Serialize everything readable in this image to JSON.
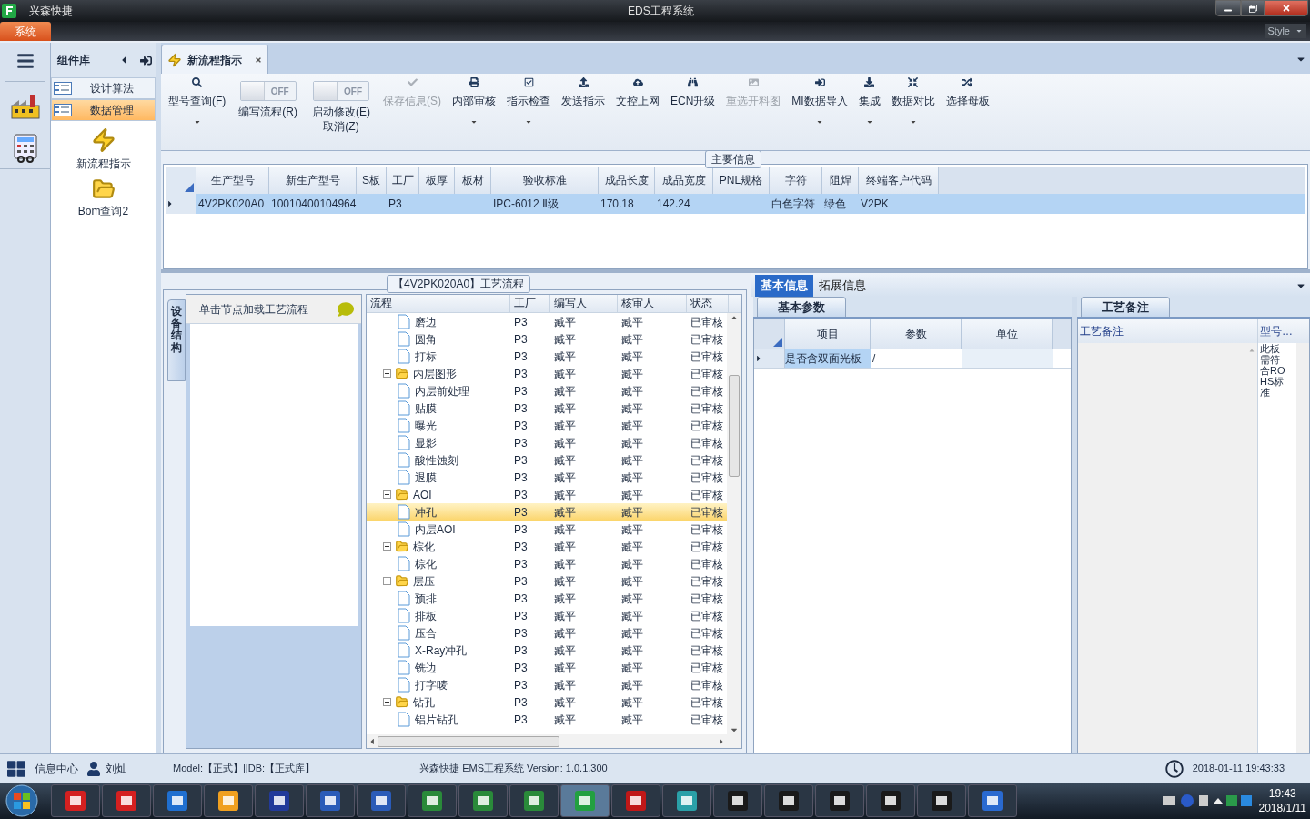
{
  "window": {
    "app_name": "兴森快捷",
    "title": "EDS工程系统"
  },
  "ribbon_tabs": [
    {
      "label": "系统",
      "selected": true
    }
  ],
  "style_menu": {
    "label": "Style"
  },
  "component_panel": {
    "title": "组件库",
    "items": [
      {
        "label": "设计算法",
        "selected": false
      },
      {
        "label": "数据管理",
        "selected": true
      }
    ],
    "tools": [
      {
        "label": "新流程指示"
      },
      {
        "label": "Bom查询2"
      }
    ]
  },
  "document_tabs": [
    {
      "label": "新流程指示",
      "selected": true
    }
  ],
  "toolbar": [
    {
      "kind": "button",
      "label": "型号查询(F)",
      "disabled": false,
      "dropdown": true
    },
    {
      "kind": "toggle",
      "label": "编写流程(R)",
      "switch_text": "OFF",
      "on": false
    },
    {
      "kind": "toggle",
      "label": "启动修改(E)\n取消(Z)",
      "switch_text": "OFF",
      "on": false
    },
    {
      "kind": "button",
      "label": "保存信息(S)",
      "disabled": true,
      "dropdown": false
    },
    {
      "kind": "button",
      "label": "内部审核",
      "disabled": false,
      "dropdown": true
    },
    {
      "kind": "button",
      "label": "指示检查",
      "disabled": false,
      "dropdown": true
    },
    {
      "kind": "button",
      "label": "发送指示",
      "disabled": false,
      "dropdown": false
    },
    {
      "kind": "button",
      "label": "文控上网",
      "disabled": false,
      "dropdown": false
    },
    {
      "kind": "button",
      "label": "ECN升级",
      "disabled": false,
      "dropdown": false
    },
    {
      "kind": "button",
      "label": "重选开料图",
      "disabled": true,
      "dropdown": false
    },
    {
      "kind": "button",
      "label": "MI数据导入",
      "disabled": false,
      "dropdown": true
    },
    {
      "kind": "button",
      "label": "集成",
      "disabled": false,
      "dropdown": true
    },
    {
      "kind": "button",
      "label": "数据对比",
      "disabled": false,
      "dropdown": true
    },
    {
      "kind": "button",
      "label": "选择母板",
      "disabled": false,
      "dropdown": false
    }
  ],
  "main_info": {
    "title": "主要信息",
    "columns": [
      "生产型号",
      "新生产型号",
      "S板",
      "工厂",
      "板厚",
      "板材",
      "验收标准",
      "成品长度",
      "成品宽度",
      "PNL规格",
      "字符",
      "阻焊",
      "终端客户代码"
    ],
    "rows": [
      {
        "selected": true,
        "cells": [
          "4V2PK020A0",
          "10010400104964",
          null,
          "P3",
          null,
          null,
          "IPC-6012 Ⅱ级",
          "170.18",
          "142.24",
          null,
          "白色字符",
          "绿色",
          "V2PK"
        ]
      }
    ]
  },
  "process_panel": {
    "title": "【4V2PK020A0】工艺流程",
    "side_tab": "设备结构",
    "hint": "单击节点加载工艺流程",
    "columns": [
      "流程",
      "工厂",
      "编写人",
      "核审人",
      "状态"
    ],
    "nodes": [
      {
        "kind": "leaf",
        "name": "磨边",
        "factory": "P3",
        "writer": "臧平",
        "reviewer": "臧平",
        "status": "已审核",
        "selected": false
      },
      {
        "kind": "leaf",
        "name": "圆角",
        "factory": "P3",
        "writer": "臧平",
        "reviewer": "臧平",
        "status": "已审核",
        "selected": false
      },
      {
        "kind": "leaf",
        "name": "打标",
        "factory": "P3",
        "writer": "臧平",
        "reviewer": "臧平",
        "status": "已审核",
        "selected": false
      },
      {
        "kind": "folder",
        "name": "内层图形",
        "factory": "P3",
        "writer": "臧平",
        "reviewer": "臧平",
        "status": "已审核",
        "selected": false,
        "expanded": true,
        "children": [
          {
            "kind": "leaf",
            "name": "内层前处理",
            "factory": "P3",
            "writer": "臧平",
            "reviewer": "臧平",
            "status": "已审核",
            "selected": false
          },
          {
            "kind": "leaf",
            "name": "贴膜",
            "factory": "P3",
            "writer": "臧平",
            "reviewer": "臧平",
            "status": "已审核",
            "selected": false
          },
          {
            "kind": "leaf",
            "name": "曝光",
            "factory": "P3",
            "writer": "臧平",
            "reviewer": "臧平",
            "status": "已审核",
            "selected": false
          },
          {
            "kind": "leaf",
            "name": "显影",
            "factory": "P3",
            "writer": "臧平",
            "reviewer": "臧平",
            "status": "已审核",
            "selected": false
          },
          {
            "kind": "leaf",
            "name": "酸性蚀刻",
            "factory": "P3",
            "writer": "臧平",
            "reviewer": "臧平",
            "status": "已审核",
            "selected": false
          },
          {
            "kind": "leaf",
            "name": "退膜",
            "factory": "P3",
            "writer": "臧平",
            "reviewer": "臧平",
            "status": "已审核",
            "selected": false
          }
        ]
      },
      {
        "kind": "folder",
        "name": "AOI",
        "factory": "P3",
        "writer": "臧平",
        "reviewer": "臧平",
        "status": "已审核",
        "selected": false,
        "expanded": true,
        "children": [
          {
            "kind": "leaf",
            "name": "冲孔",
            "factory": "P3",
            "writer": "臧平",
            "reviewer": "臧平",
            "status": "已审核",
            "selected": true
          },
          {
            "kind": "leaf",
            "name": "内层AOI",
            "factory": "P3",
            "writer": "臧平",
            "reviewer": "臧平",
            "status": "已审核",
            "selected": false
          }
        ]
      },
      {
        "kind": "folder",
        "name": "棕化",
        "factory": "P3",
        "writer": "臧平",
        "reviewer": "臧平",
        "status": "已审核",
        "selected": false,
        "expanded": true,
        "children": [
          {
            "kind": "leaf",
            "name": "棕化",
            "factory": "P3",
            "writer": "臧平",
            "reviewer": "臧平",
            "status": "已审核",
            "selected": false
          }
        ]
      },
      {
        "kind": "folder",
        "name": "层压",
        "factory": "P3",
        "writer": "臧平",
        "reviewer": "臧平",
        "status": "已审核",
        "selected": false,
        "expanded": true,
        "children": [
          {
            "kind": "leaf",
            "name": "预排",
            "factory": "P3",
            "writer": "臧平",
            "reviewer": "臧平",
            "status": "已审核",
            "selected": false
          },
          {
            "kind": "leaf",
            "name": "排板",
            "factory": "P3",
            "writer": "臧平",
            "reviewer": "臧平",
            "status": "已审核",
            "selected": false
          },
          {
            "kind": "leaf",
            "name": "压合",
            "factory": "P3",
            "writer": "臧平",
            "reviewer": "臧平",
            "status": "已审核",
            "selected": false
          },
          {
            "kind": "leaf",
            "name": "X-Ray冲孔",
            "factory": "P3",
            "writer": "臧平",
            "reviewer": "臧平",
            "status": "已审核",
            "selected": false
          },
          {
            "kind": "leaf",
            "name": "铣边",
            "factory": "P3",
            "writer": "臧平",
            "reviewer": "臧平",
            "status": "已审核",
            "selected": false
          },
          {
            "kind": "leaf",
            "name": "打字唛",
            "factory": "P3",
            "writer": "臧平",
            "reviewer": "臧平",
            "status": "已审核",
            "selected": false
          }
        ]
      },
      {
        "kind": "folder",
        "name": "钻孔",
        "factory": "P3",
        "writer": "臧平",
        "reviewer": "臧平",
        "status": "已审核",
        "selected": false,
        "expanded": true,
        "children": [
          {
            "kind": "leaf",
            "name": "铝片钻孔",
            "factory": "P3",
            "writer": "臧平",
            "reviewer": "臧平",
            "status": "已审核",
            "selected": false
          }
        ]
      }
    ]
  },
  "detail_tabs": [
    {
      "label": "基本信息",
      "selected": true
    },
    {
      "label": "拓展信息",
      "selected": false
    }
  ],
  "basic_params": {
    "tab": "基本参数",
    "columns": [
      "项目",
      "参数",
      "单位"
    ],
    "rows": [
      {
        "item": "是否含双面光板",
        "value": "/"
      }
    ]
  },
  "process_notes": {
    "tab": "工艺备注",
    "columns": [
      "工艺备注",
      "型号…"
    ],
    "note": "此板需符合ROHS标准"
  },
  "status_bar": {
    "info_center": "信息中心",
    "user": "刘灿",
    "model": "Model:【正式】||DB:【正式库】",
    "product": "兴森快捷 EMS工程系统 Version: 1.0.1.300",
    "datetime": "2018-01-11 19:43:33"
  },
  "taskbar": {
    "time": "19:43",
    "date": "2018/1/11"
  }
}
